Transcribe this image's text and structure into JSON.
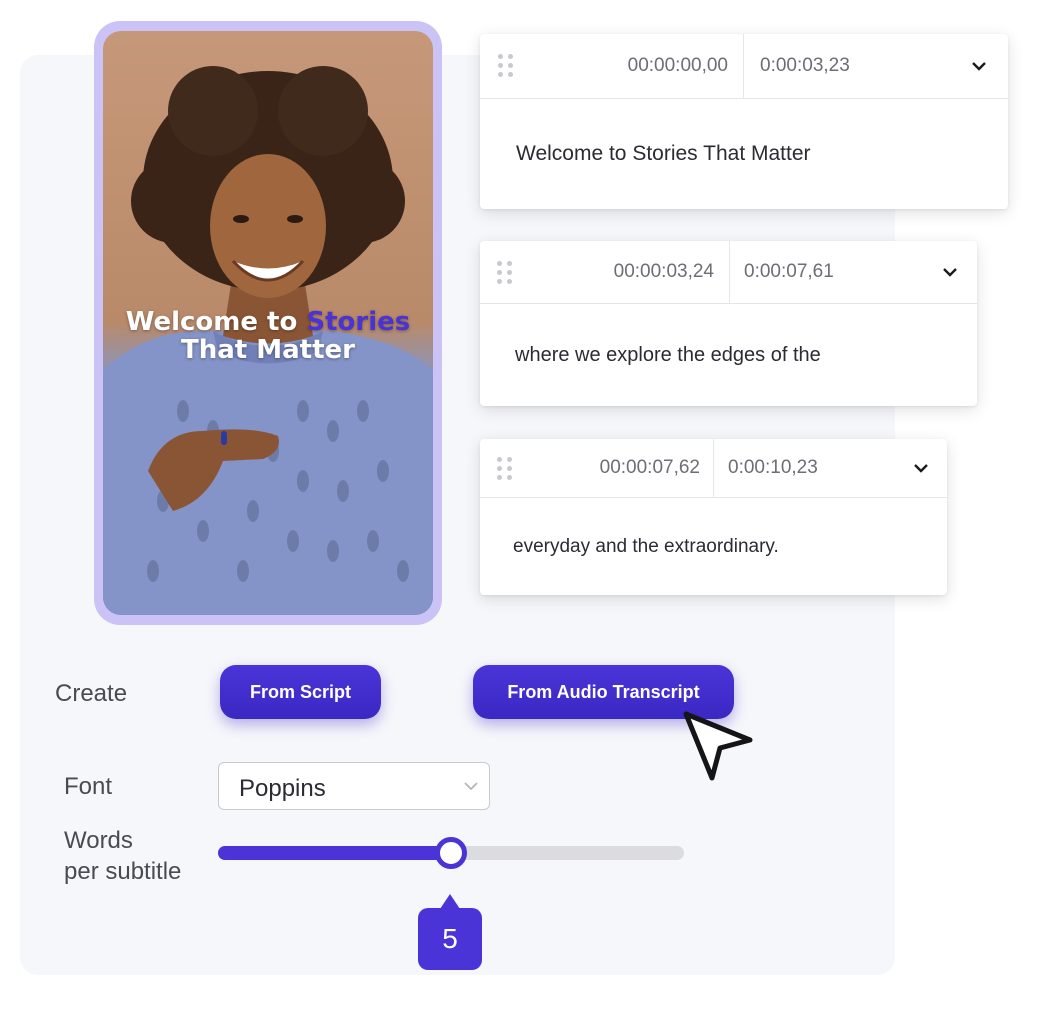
{
  "preview": {
    "caption_line1_prefix": "Welcome to ",
    "caption_line1_accent": "Stories",
    "caption_line2": "That Matter"
  },
  "subtitles": [
    {
      "start": "00:00:00,00",
      "end": "0:00:03,23",
      "text": "Welcome to Stories That Matter"
    },
    {
      "start": "00:00:03,24",
      "end": "0:00:07,61",
      "text": "where we explore the edges of the"
    },
    {
      "start": "00:00:07,62",
      "end": "0:00:10,23",
      "text": "everyday and the extraordinary."
    }
  ],
  "controls": {
    "create_label": "Create",
    "from_script_label": "From Script",
    "from_audio_label": "From Audio Transcript",
    "font_label": "Font",
    "font_value": "Poppins",
    "words_label_line1": "Words",
    "words_label_line2": "per subtitle",
    "words_value": "5",
    "words_fraction": 0.5
  },
  "colors": {
    "accent": "#4a34d8",
    "phone_frame": "#cbc3f5"
  }
}
